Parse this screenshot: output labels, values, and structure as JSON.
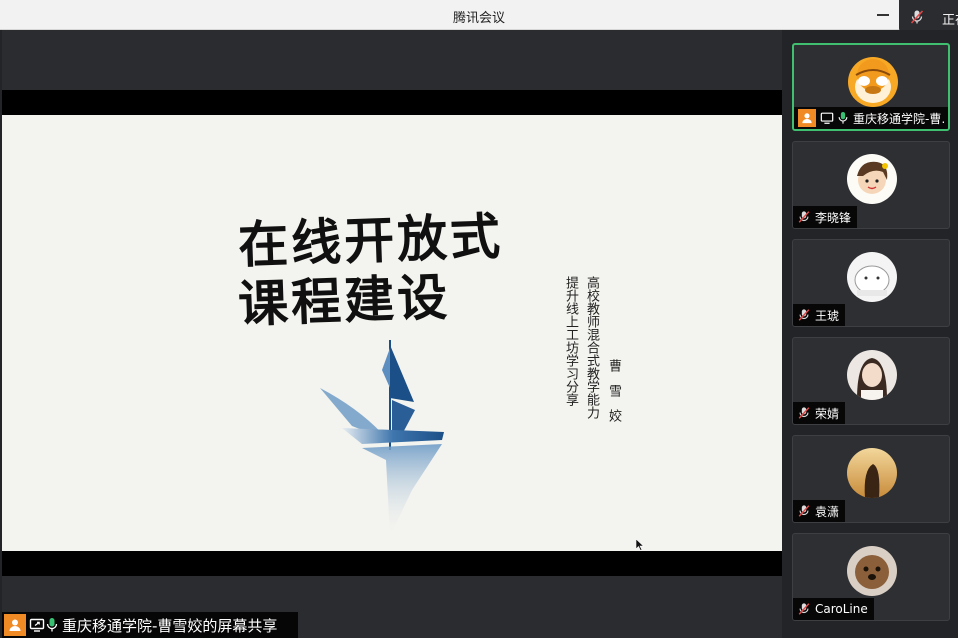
{
  "window": {
    "title": "腾讯会议",
    "speaking_indicator": "正在"
  },
  "slide": {
    "title_line1": "在线开放式",
    "title_line2": "课程建设",
    "vertical_line1": "提升线上工坊学习分享",
    "vertical_line2": "高校教师混合式教学能力",
    "author": "曹雪姣"
  },
  "share_label": "重庆移通学院-曹雪姣的屏幕共享",
  "participants": [
    {
      "name": "重庆移通学院-曹…",
      "host": true,
      "mic": "on",
      "sharing": true
    },
    {
      "name": "李晓锋",
      "mic": "muted"
    },
    {
      "name": "王琥",
      "mic": "muted"
    },
    {
      "name": "荣婧",
      "mic": "muted"
    },
    {
      "name": "袁潇",
      "mic": "muted"
    },
    {
      "name": "CaroLine",
      "mic": "muted"
    }
  ],
  "icons": {
    "host": "person-icon",
    "share": "screen-share-icon",
    "mic_on": "microphone-icon",
    "mic_muted": "microphone-muted-icon"
  },
  "colors": {
    "accent_orange": "#f08a24",
    "active_green": "#3fbf6f",
    "mic_green": "#38c172",
    "muted_red": "#e04848",
    "boat_blue": "#1b4f87"
  }
}
